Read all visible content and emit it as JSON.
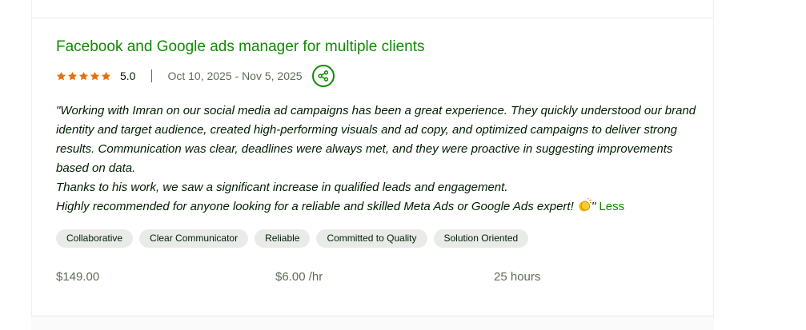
{
  "job": {
    "title": "Facebook and Google ads manager for multiple clients",
    "rating": "5.0",
    "stars_filled": 5,
    "stars_total": 5,
    "date_range": "Oct 10, 2025 - Nov 5, 2025",
    "share_icon": "share-icon",
    "review_lines": [
      "\"Working with Imran on our social media ad campaigns has been a great experience. They quickly understood our brand identity and target audience, created high-performing visuals and ad copy, and optimized campaigns to deliver strong results. Communication was clear, deadlines were always met, and they were proactive in suggesting improvements based on data.",
      "Thanks to his work, we saw a significant increase in qualified leads and engagement.",
      "Highly recommended for anyone looking for a reliable and skilled Meta Ads or Google Ads expert!"
    ],
    "review_end_emoji": "clapping-hands-icon",
    "review_close_quote": "\"",
    "less_label": "Less",
    "tags": [
      "Collaborative",
      "Clear Communicator",
      "Reliable",
      "Committed to Quality",
      "Solution Oriented"
    ],
    "total_earned": "$149.00",
    "hourly_rate": "$6.00 /hr",
    "hours": "25 hours"
  },
  "colors": {
    "brand_green": "#108a00",
    "star_orange": "#e5700f",
    "text_dark": "#001e00",
    "text_muted": "#5e6d55",
    "tag_bg": "#e9ebe9"
  }
}
